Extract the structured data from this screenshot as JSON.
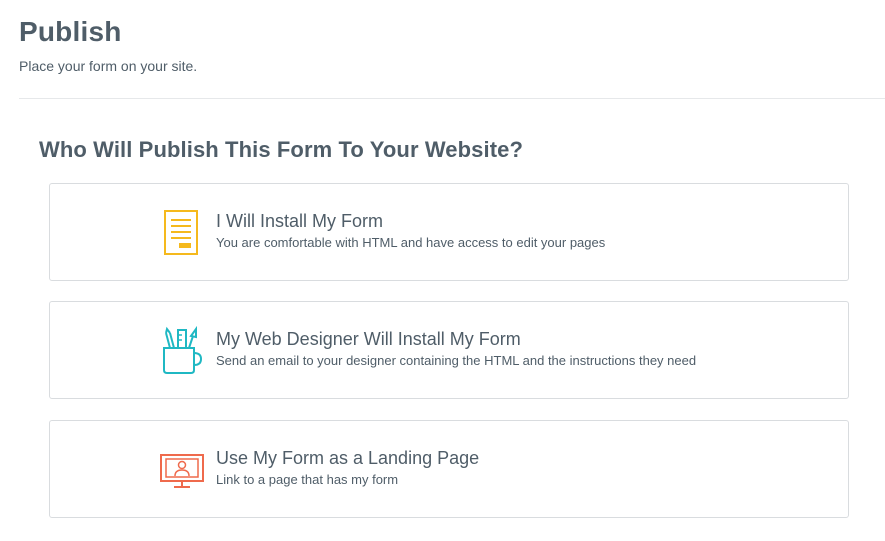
{
  "header": {
    "title": "Publish",
    "subtitle": "Place your form on your site."
  },
  "section": {
    "title": "Who Will Publish This Form To Your Website?"
  },
  "options": [
    {
      "title": "I Will Install My Form",
      "description": "You are comfortable with HTML and have access to edit your pages",
      "icon": "form-document-icon",
      "color": "#f5b91d"
    },
    {
      "title": "My Web Designer Will Install My Form",
      "description": "Send an email to your designer containing the HTML and the instructions they need",
      "icon": "designer-tools-mug-icon",
      "color": "#1fb8c3"
    },
    {
      "title": "Use My Form as a Landing Page",
      "description": "Link to a page that has my form",
      "icon": "landing-page-monitor-icon",
      "color": "#ef6a4c"
    }
  ]
}
